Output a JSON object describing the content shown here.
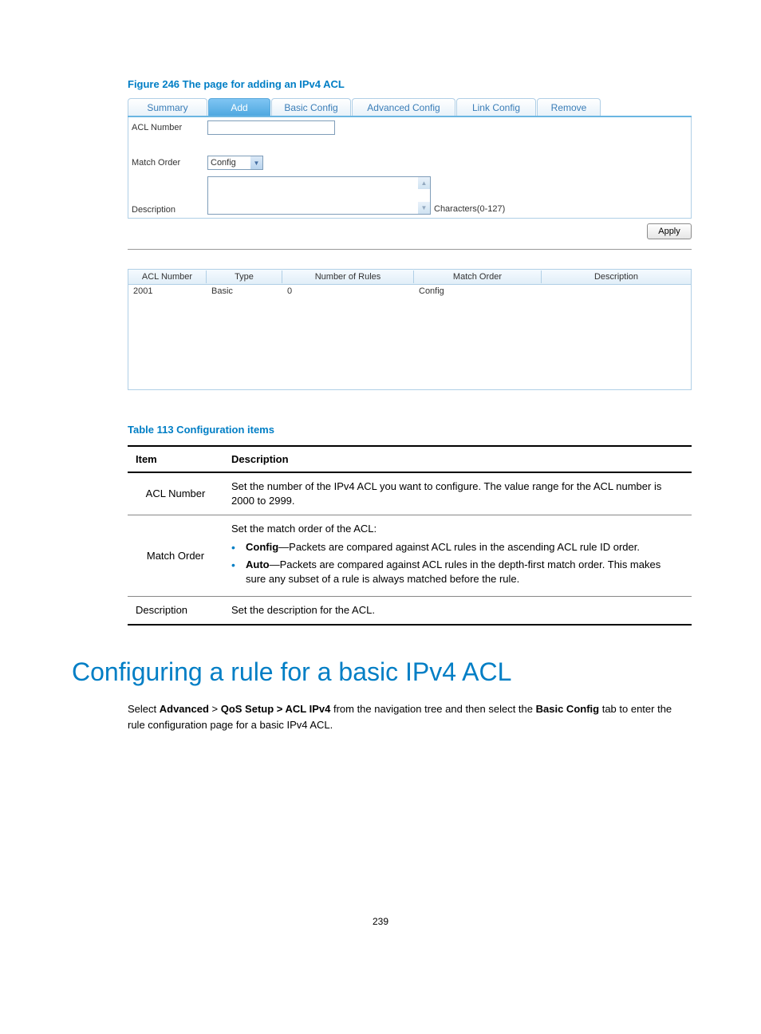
{
  "figure_caption": "Figure 246 The page for adding an IPv4 ACL",
  "tabs": {
    "summary": "Summary",
    "add": "Add",
    "basic_config": "Basic Config",
    "advanced_config": "Advanced Config",
    "link_config": "Link Config",
    "remove": "Remove"
  },
  "form": {
    "acl_number_label": "ACL Number",
    "match_order_label": "Match Order",
    "match_order_value": "Config",
    "description_label": "Description",
    "char_hint": "Characters(0-127)",
    "apply_label": "Apply"
  },
  "grid": {
    "headers": {
      "acl_number": "ACL Number",
      "type": "Type",
      "num_rules": "Number of Rules",
      "match_order": "Match Order",
      "description": "Description"
    },
    "rows": [
      {
        "acl_number": "2001",
        "type": "Basic",
        "num_rules": "0",
        "match_order": "Config",
        "description": ""
      }
    ]
  },
  "table_caption": "Table 113 Configuration items",
  "desc_table": {
    "headers": {
      "item": "Item",
      "description": "Description"
    },
    "rows": {
      "acl_number": {
        "item": "ACL Number",
        "desc": "Set the number of the IPv4 ACL you want to configure. The value range for the ACL number is 2000 to 2999."
      },
      "match_order": {
        "item": "Match Order",
        "intro": "Set the match order of the ACL:",
        "bullet1_bold": "Config",
        "bullet1_rest": "—Packets are compared against ACL rules in the ascending ACL rule ID order.",
        "bullet2_bold": "Auto",
        "bullet2_rest": "—Packets are compared against ACL rules in the depth-first match order. This makes sure any subset of a rule is always matched before the rule."
      },
      "description": {
        "item": "Description",
        "desc": "Set the description for the ACL."
      }
    }
  },
  "heading": "Configuring a rule for a basic IPv4 ACL",
  "para": {
    "pre": "Select ",
    "b1": "Advanced",
    "sep1": " > ",
    "b2": "QoS Setup > ACL IPv4",
    "mid": " from the navigation tree and then select the ",
    "b3": "Basic Config",
    "post": " tab to enter the rule configuration page for a basic IPv4 ACL."
  },
  "page_number": "239"
}
